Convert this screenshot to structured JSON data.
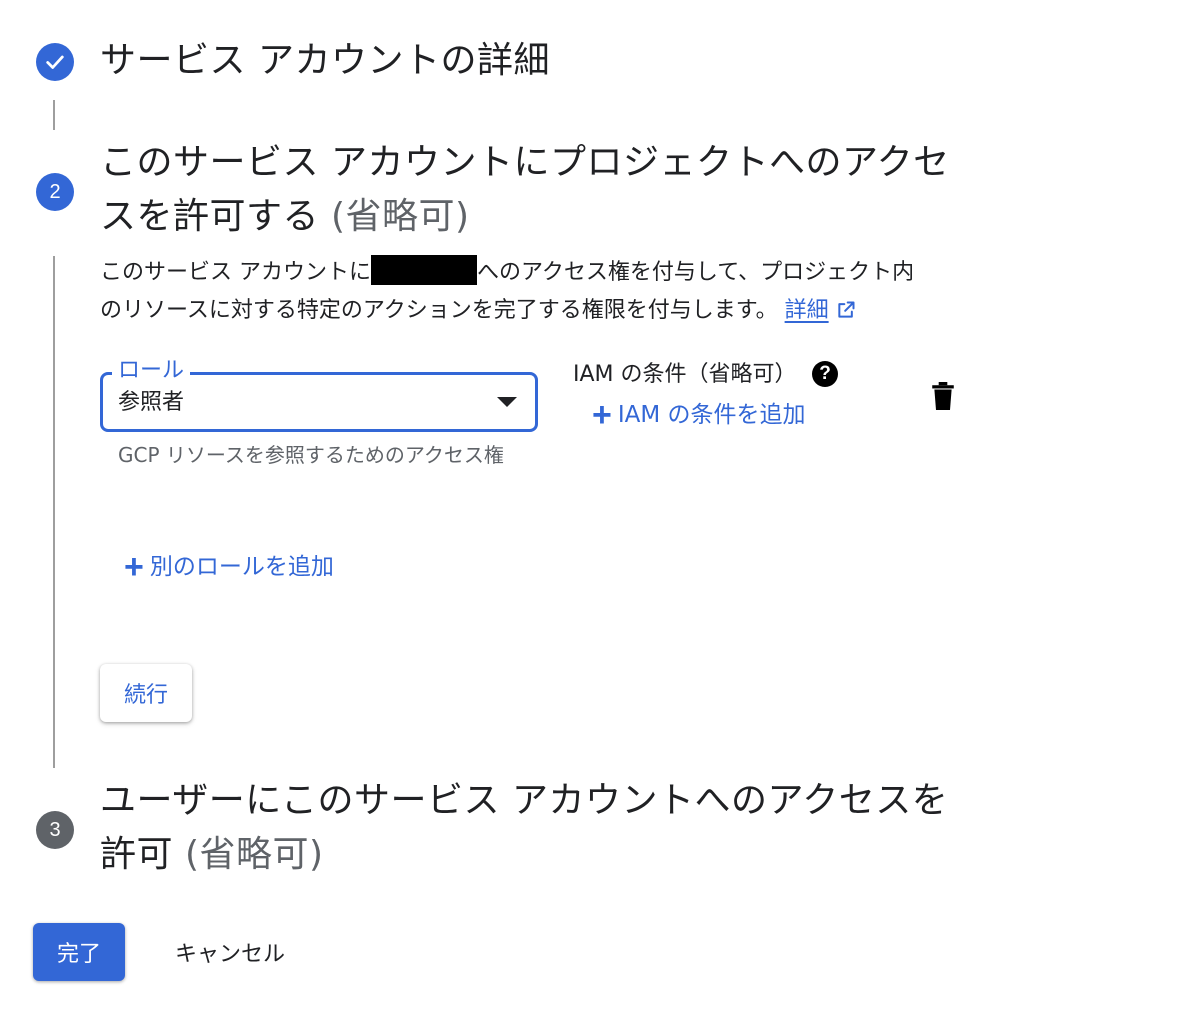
{
  "steps": {
    "step1": {
      "title": "サービス アカウントの詳細"
    },
    "step2": {
      "number": "2",
      "title_line1": "このサービス アカウントにプロジェクトへのアクセ",
      "title_line2": "スを許可する",
      "optional": "(省略可)",
      "desc_part1": "このサービス アカウントに",
      "desc_part2": "へのアクセス権を付与して、プロジェクト内",
      "desc_line2": "のリソースに対する特定のアクションを完了する権限を付与します。",
      "learn_more": "詳細"
    },
    "step3": {
      "number": "3",
      "title_line1": "ユーザーにこのサービス アカウントへのアクセスを",
      "title_line2": "許可",
      "optional": "(省略可)"
    }
  },
  "role": {
    "label": "ロール",
    "value": "参照者",
    "helper": "GCP リソースを参照するためのアクセス権"
  },
  "iam_condition": {
    "label": "IAM の条件（省略可）",
    "add_label": "IAM の条件を追加"
  },
  "add_role_label": "別のロールを追加",
  "buttons": {
    "continue": "続行",
    "done": "完了",
    "cancel": "キャンセル"
  },
  "colors": {
    "accent": "#3367d6",
    "step_inactive": "#5f6368"
  }
}
